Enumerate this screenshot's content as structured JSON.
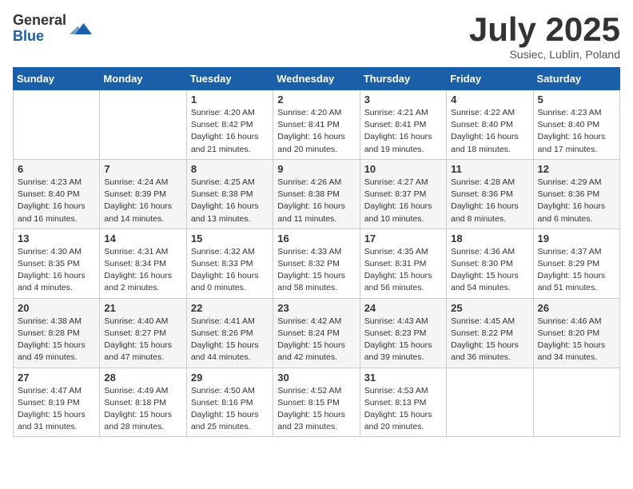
{
  "logo": {
    "general": "General",
    "blue": "Blue"
  },
  "title": "July 2025",
  "subtitle": "Susiec, Lublin, Poland",
  "days_of_week": [
    "Sunday",
    "Monday",
    "Tuesday",
    "Wednesday",
    "Thursday",
    "Friday",
    "Saturday"
  ],
  "weeks": [
    [
      {
        "day": null,
        "info": null
      },
      {
        "day": null,
        "info": null
      },
      {
        "day": "1",
        "info": "Sunrise: 4:20 AM\nSunset: 8:42 PM\nDaylight: 16 hours\nand 21 minutes."
      },
      {
        "day": "2",
        "info": "Sunrise: 4:20 AM\nSunset: 8:41 PM\nDaylight: 16 hours\nand 20 minutes."
      },
      {
        "day": "3",
        "info": "Sunrise: 4:21 AM\nSunset: 8:41 PM\nDaylight: 16 hours\nand 19 minutes."
      },
      {
        "day": "4",
        "info": "Sunrise: 4:22 AM\nSunset: 8:40 PM\nDaylight: 16 hours\nand 18 minutes."
      },
      {
        "day": "5",
        "info": "Sunrise: 4:23 AM\nSunset: 8:40 PM\nDaylight: 16 hours\nand 17 minutes."
      }
    ],
    [
      {
        "day": "6",
        "info": "Sunrise: 4:23 AM\nSunset: 8:40 PM\nDaylight: 16 hours\nand 16 minutes."
      },
      {
        "day": "7",
        "info": "Sunrise: 4:24 AM\nSunset: 8:39 PM\nDaylight: 16 hours\nand 14 minutes."
      },
      {
        "day": "8",
        "info": "Sunrise: 4:25 AM\nSunset: 8:38 PM\nDaylight: 16 hours\nand 13 minutes."
      },
      {
        "day": "9",
        "info": "Sunrise: 4:26 AM\nSunset: 8:38 PM\nDaylight: 16 hours\nand 11 minutes."
      },
      {
        "day": "10",
        "info": "Sunrise: 4:27 AM\nSunset: 8:37 PM\nDaylight: 16 hours\nand 10 minutes."
      },
      {
        "day": "11",
        "info": "Sunrise: 4:28 AM\nSunset: 8:36 PM\nDaylight: 16 hours\nand 8 minutes."
      },
      {
        "day": "12",
        "info": "Sunrise: 4:29 AM\nSunset: 8:36 PM\nDaylight: 16 hours\nand 6 minutes."
      }
    ],
    [
      {
        "day": "13",
        "info": "Sunrise: 4:30 AM\nSunset: 8:35 PM\nDaylight: 16 hours\nand 4 minutes."
      },
      {
        "day": "14",
        "info": "Sunrise: 4:31 AM\nSunset: 8:34 PM\nDaylight: 16 hours\nand 2 minutes."
      },
      {
        "day": "15",
        "info": "Sunrise: 4:32 AM\nSunset: 8:33 PM\nDaylight: 16 hours\nand 0 minutes."
      },
      {
        "day": "16",
        "info": "Sunrise: 4:33 AM\nSunset: 8:32 PM\nDaylight: 15 hours\nand 58 minutes."
      },
      {
        "day": "17",
        "info": "Sunrise: 4:35 AM\nSunset: 8:31 PM\nDaylight: 15 hours\nand 56 minutes."
      },
      {
        "day": "18",
        "info": "Sunrise: 4:36 AM\nSunset: 8:30 PM\nDaylight: 15 hours\nand 54 minutes."
      },
      {
        "day": "19",
        "info": "Sunrise: 4:37 AM\nSunset: 8:29 PM\nDaylight: 15 hours\nand 51 minutes."
      }
    ],
    [
      {
        "day": "20",
        "info": "Sunrise: 4:38 AM\nSunset: 8:28 PM\nDaylight: 15 hours\nand 49 minutes."
      },
      {
        "day": "21",
        "info": "Sunrise: 4:40 AM\nSunset: 8:27 PM\nDaylight: 15 hours\nand 47 minutes."
      },
      {
        "day": "22",
        "info": "Sunrise: 4:41 AM\nSunset: 8:26 PM\nDaylight: 15 hours\nand 44 minutes."
      },
      {
        "day": "23",
        "info": "Sunrise: 4:42 AM\nSunset: 8:24 PM\nDaylight: 15 hours\nand 42 minutes."
      },
      {
        "day": "24",
        "info": "Sunrise: 4:43 AM\nSunset: 8:23 PM\nDaylight: 15 hours\nand 39 minutes."
      },
      {
        "day": "25",
        "info": "Sunrise: 4:45 AM\nSunset: 8:22 PM\nDaylight: 15 hours\nand 36 minutes."
      },
      {
        "day": "26",
        "info": "Sunrise: 4:46 AM\nSunset: 8:20 PM\nDaylight: 15 hours\nand 34 minutes."
      }
    ],
    [
      {
        "day": "27",
        "info": "Sunrise: 4:47 AM\nSunset: 8:19 PM\nDaylight: 15 hours\nand 31 minutes."
      },
      {
        "day": "28",
        "info": "Sunrise: 4:49 AM\nSunset: 8:18 PM\nDaylight: 15 hours\nand 28 minutes."
      },
      {
        "day": "29",
        "info": "Sunrise: 4:50 AM\nSunset: 8:16 PM\nDaylight: 15 hours\nand 25 minutes."
      },
      {
        "day": "30",
        "info": "Sunrise: 4:52 AM\nSunset: 8:15 PM\nDaylight: 15 hours\nand 23 minutes."
      },
      {
        "day": "31",
        "info": "Sunrise: 4:53 AM\nSunset: 8:13 PM\nDaylight: 15 hours\nand 20 minutes."
      },
      {
        "day": null,
        "info": null
      },
      {
        "day": null,
        "info": null
      }
    ]
  ]
}
